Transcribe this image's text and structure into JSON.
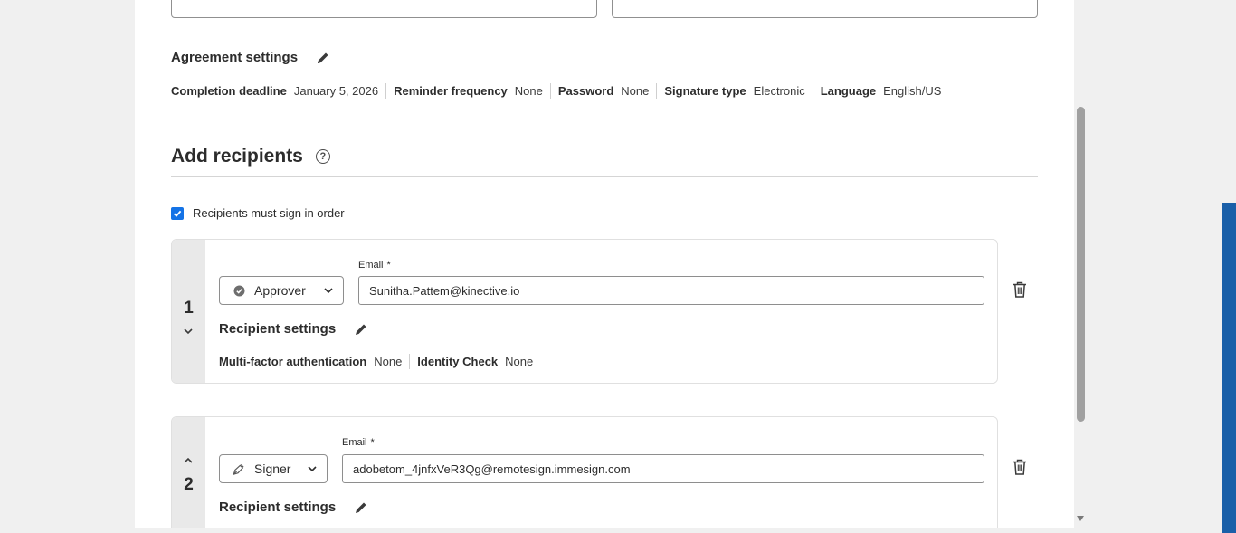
{
  "agreement_settings": {
    "title": "Agreement settings",
    "items": [
      {
        "label": "Completion deadline",
        "value": "January 5, 2026"
      },
      {
        "label": "Reminder frequency",
        "value": "None"
      },
      {
        "label": "Password",
        "value": "None"
      },
      {
        "label": "Signature type",
        "value": "Electronic"
      },
      {
        "label": "Language",
        "value": "English/US"
      }
    ]
  },
  "recipients": {
    "title": "Add recipients",
    "help_icon": "?",
    "sign_in_order": {
      "label": "Recipients must sign in order",
      "checked": true
    },
    "list": [
      {
        "number": "1",
        "role": "Approver",
        "role_icon": "approver-check-icon",
        "email_label": "Email",
        "required_mark": "*",
        "email": "Sunitha.Pattem@kinective.io",
        "settings_title": "Recipient settings",
        "settings": [
          {
            "label": "Multi-factor authentication",
            "value": "None"
          },
          {
            "label": "Identity Check",
            "value": "None"
          }
        ]
      },
      {
        "number": "2",
        "role": "Signer",
        "role_icon": "signer-pen-icon",
        "email_label": "Email",
        "required_mark": "*",
        "email": "adobetom_4jnfxVeR3Qg@remotesign.immesign.com",
        "settings_title": "Recipient settings"
      }
    ]
  },
  "colors": {
    "accent": "#1473e6",
    "side_bar": "#1a5fa8"
  }
}
